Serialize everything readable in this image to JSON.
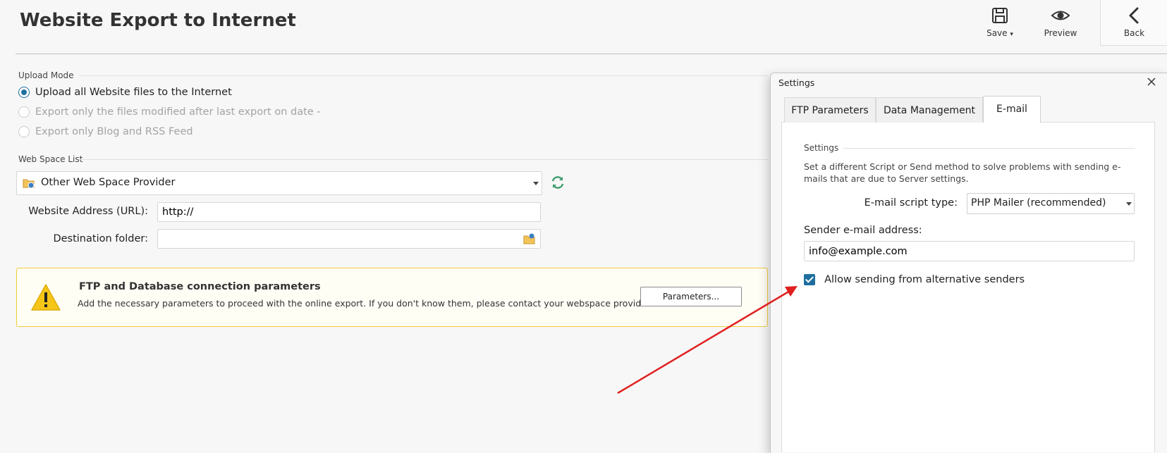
{
  "header": {
    "title": "Website Export to Internet",
    "save_label": "Save",
    "preview_label": "Preview",
    "back_label": "Back"
  },
  "upload_mode": {
    "section_label": "Upload Mode",
    "options": [
      {
        "label": "Upload all Website files to the Internet",
        "selected": true,
        "enabled": true
      },
      {
        "label": "Export only the files modified after last export on date -",
        "selected": false,
        "enabled": false
      },
      {
        "label": "Export only Blog and RSS Feed",
        "selected": false,
        "enabled": false
      }
    ]
  },
  "web_space": {
    "section_label": "Web Space List",
    "provider": "Other Web Space Provider",
    "url_label": "Website Address (URL):",
    "url_value": "http://",
    "folder_label": "Destination folder:",
    "folder_value": ""
  },
  "warning": {
    "title": "FTP and Database connection parameters",
    "text": "Add the necessary parameters to proceed with the online export. If you don't know them, please contact your webspace provider.",
    "button_label": "Parameters..."
  },
  "settings_dialog": {
    "title": "Settings",
    "tabs": [
      {
        "label": "FTP Parameters",
        "active": false
      },
      {
        "label": "Data Management",
        "active": false
      },
      {
        "label": "E-mail",
        "active": true
      }
    ],
    "section_label": "Settings",
    "description": "Set a different Script or Send method to solve problems with sending e-mails that are due to Server settings.",
    "script_type_label": "E-mail script type:",
    "script_type_value": "PHP Mailer (recommended)",
    "sender_label": "Sender e-mail address:",
    "sender_value": "info@example.com",
    "alt_senders_label": "Allow sending from alternative senders",
    "alt_senders_checked": true
  },
  "colors": {
    "accent": "#1e6f9f",
    "warning_border": "#f2cc3c",
    "annotation_arrow": "#e02020"
  }
}
